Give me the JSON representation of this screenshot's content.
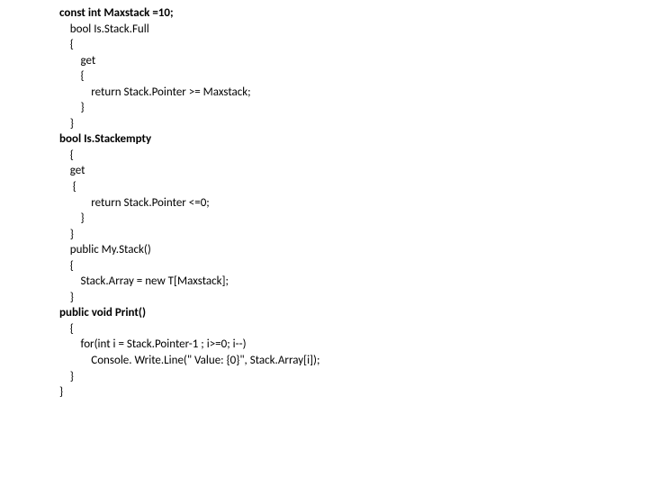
{
  "code": {
    "lines": [
      {
        "text": "const int Maxstack =10;",
        "indent": 0,
        "bold": true
      },
      {
        "text": "bool Is.Stack.Full",
        "indent": 1,
        "bold": false
      },
      {
        "text": "{",
        "indent": 1,
        "bold": false
      },
      {
        "text": "get",
        "indent": 2,
        "bold": false
      },
      {
        "text": "{",
        "indent": 2,
        "bold": false
      },
      {
        "text": "return Stack.Pointer >= Maxstack;",
        "indent": 3,
        "bold": false
      },
      {
        "text": "}",
        "indent": 2,
        "bold": false
      },
      {
        "text": "}",
        "indent": 1,
        "bold": false
      },
      {
        "text": "",
        "indent": 0,
        "bold": false
      },
      {
        "text": "bool Is.Stackempty",
        "indent": 0,
        "bold": true
      },
      {
        "text": "{",
        "indent": 1,
        "bold": false
      },
      {
        "text": "get",
        "indent": 1,
        "bold": false
      },
      {
        "text": " {",
        "indent": 1,
        "bold": false
      },
      {
        "text": "return Stack.Pointer <=0;",
        "indent": 3,
        "bold": false
      },
      {
        "text": "}",
        "indent": 2,
        "bold": false
      },
      {
        "text": "}",
        "indent": 1,
        "bold": false
      },
      {
        "text": "public My.Stack()",
        "indent": 1,
        "bold": false
      },
      {
        "text": "{",
        "indent": 1,
        "bold": false
      },
      {
        "text": "Stack.Array = new T[Maxstack];",
        "indent": 2,
        "bold": false
      },
      {
        "text": "}",
        "indent": 1,
        "bold": false
      },
      {
        "text": "public void Print()",
        "indent": 0,
        "bold": true
      },
      {
        "text": "{",
        "indent": 1,
        "bold": false
      },
      {
        "text": "for(int i = Stack.Pointer-1 ; i>=0; i--)",
        "indent": 2,
        "bold": false
      },
      {
        "text": "Console. Write.Line(\" Value: {0}\", Stack.Array[i]);",
        "indent": 3,
        "bold": false
      },
      {
        "text": "}",
        "indent": 1,
        "bold": false
      },
      {
        "text": "}",
        "indent": 0,
        "bold": false
      }
    ],
    "indent_unit": "    "
  }
}
